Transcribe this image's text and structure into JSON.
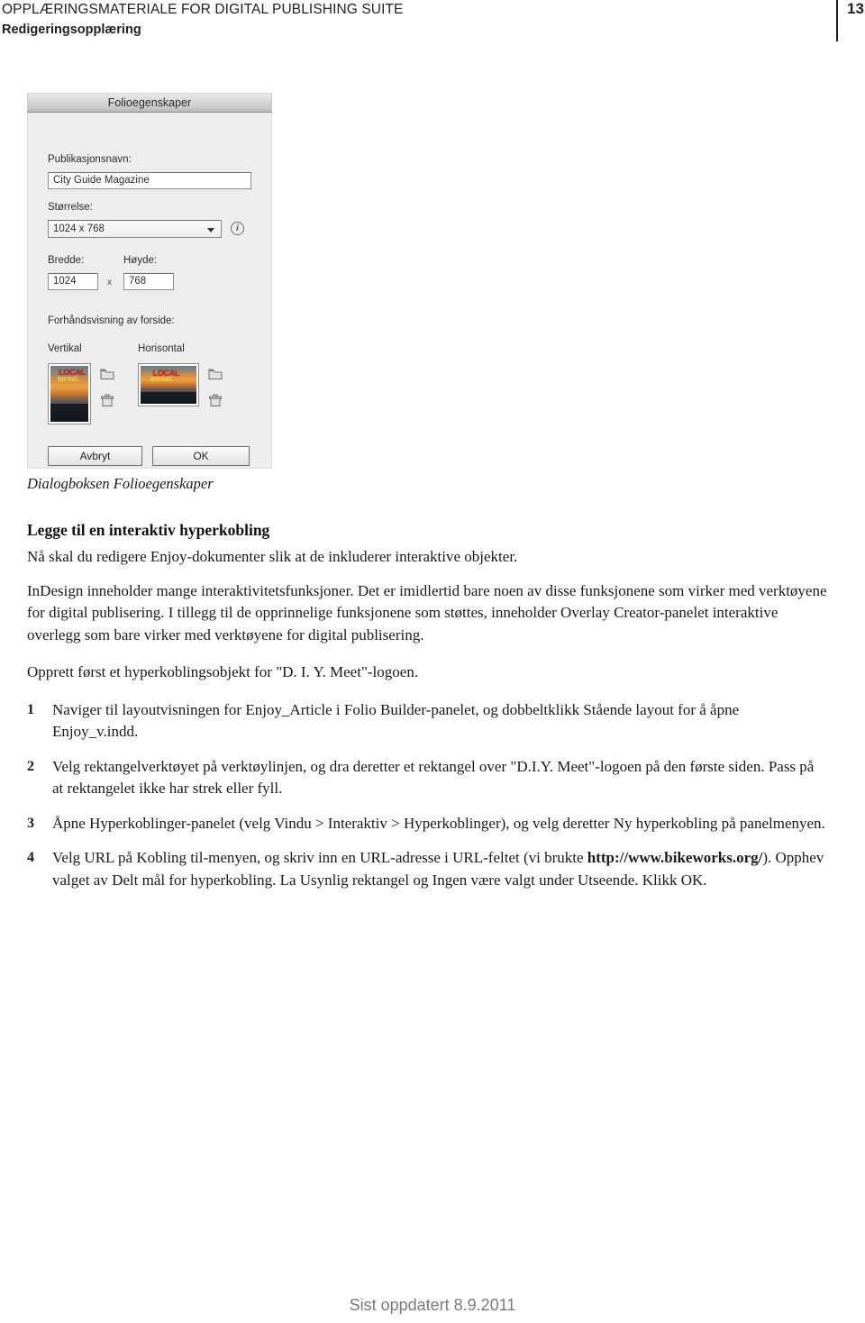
{
  "header": {
    "line1": "OPPLÆRINGSMATERIALE FOR DIGITAL PUBLISHING SUITE",
    "line2": "Redigeringsopplæring",
    "page_number": "13"
  },
  "dialog": {
    "title": "Folioegenskaper",
    "publication_label": "Publikasjonsnavn:",
    "publication_value": "City Guide Magazine",
    "size_label": "Størrelse:",
    "size_value": "1024 x 768",
    "info_icon_glyph": "i",
    "width_label": "Bredde:",
    "width_value": "1024",
    "multiply_symbol": "x",
    "height_label": "Høyde:",
    "height_value": "768",
    "preview_label": "Forhåndsvisning av forside:",
    "vertical_label": "Vertikal",
    "horizontal_label": "Horisontal",
    "thumbnail_headline": "LOCAL",
    "thumbnail_subline": "BIKING",
    "cancel_label": "Avbryt",
    "ok_label": "OK"
  },
  "caption": "Dialogboksen Folioegenskaper",
  "body": {
    "heading": "Legge til en interaktiv hyperkobling",
    "para1": "Nå skal du redigere Enjoy-dokumenter slik at de inkluderer interaktive objekter.",
    "para2": "InDesign inneholder mange interaktivitetsfunksjoner. Det er imidlertid bare noen av disse funksjonene som virker med verktøyene for digital publisering. I tillegg til de opprinnelige funksjonene som støttes, inneholder Overlay Creator-panelet interaktive overlegg som bare virker med verktøyene for digital publisering.",
    "para3": "Opprett først et hyperkoblingsobjekt for \"D. I. Y. Meet\"-logoen.",
    "steps": [
      {
        "number": "1",
        "text": "Naviger til layoutvisningen for Enjoy_Article i Folio Builder-panelet, og dobbeltklikk Stående layout for å åpne Enjoy_v.indd."
      },
      {
        "number": "2",
        "text": "Velg rektangelverktøyet på verktøylinjen, og dra deretter et rektangel over \"D.I.Y. Meet\"-logoen på den første siden. Pass på at rektangelet ikke har strek eller fyll."
      },
      {
        "number": "3",
        "text": "Åpne Hyperkoblinger-panelet (velg Vindu > Interaktiv > Hyperkoblinger), og velg deretter Ny hyperkobling på panelmenyen."
      },
      {
        "number": "4",
        "text_before": "Velg URL på Kobling til-menyen, og skriv inn en URL-adresse i URL-feltet (vi brukte ",
        "url": "http://www.bikeworks.org/",
        "text_after": "). Opphev valget av Delt mål for hyperkobling. La Usynlig rektangel og Ingen være valgt under Utseende. Klikk OK."
      }
    ]
  },
  "footer": {
    "text": "Sist oppdatert 8.9.2011"
  },
  "colors": {
    "text": "#1a1a1a",
    "footer_gray": "#7b7b7b",
    "dialog_bg": "#ededed",
    "thumb_red": "#cc2222",
    "thumb_yellow": "#f2d34a"
  }
}
